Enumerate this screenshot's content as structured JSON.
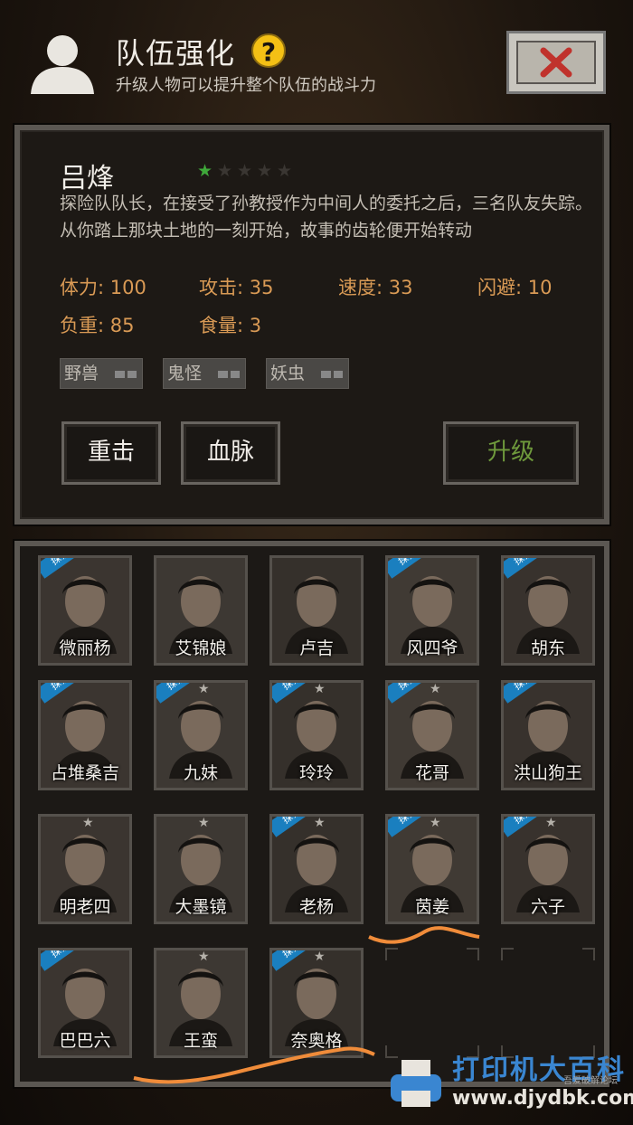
{
  "header": {
    "title": "队伍强化",
    "help_symbol": "?",
    "subtitle": "升级人物可以提升整个队伍的战斗力"
  },
  "character": {
    "name": "吕烽",
    "stars_total": 5,
    "stars_filled": 1,
    "description": "探险队队长，在接受了孙教授作为中间人的委托之后，三名队友失踪。从你踏上那块土地的一刻开始，故事的齿轮便开始转动",
    "stats": {
      "stamina": "体力: 100",
      "attack": "攻击: 35",
      "speed": "速度: 33",
      "dodge": "闪避: 10",
      "load": "负重: 85",
      "food": "食量: 3"
    },
    "tags": [
      "野兽",
      "鬼怪",
      "妖虫"
    ],
    "skills": [
      "重击",
      "血脉"
    ],
    "upgrade_label": "升级"
  },
  "roster": [
    {
      "name": "微丽杨",
      "badge": "探索",
      "star": false
    },
    {
      "name": "艾锦娘",
      "badge": "",
      "star": false
    },
    {
      "name": "卢吉",
      "badge": "",
      "star": false
    },
    {
      "name": "风四爷",
      "badge": "探索",
      "star": false
    },
    {
      "name": "胡东",
      "badge": "探索",
      "star": false
    },
    {
      "name": "占堆桑吉",
      "badge": "探索",
      "star": false
    },
    {
      "name": "九妹",
      "badge": "探索",
      "star": true
    },
    {
      "name": "玲玲",
      "badge": "探索",
      "star": true
    },
    {
      "name": "花哥",
      "badge": "探索",
      "star": true
    },
    {
      "name": "洪山狗王",
      "badge": "探索",
      "star": false
    },
    {
      "name": "明老四",
      "badge": "",
      "star": true
    },
    {
      "name": "大墨镜",
      "badge": "",
      "star": true
    },
    {
      "name": "老杨",
      "badge": "探索",
      "star": true
    },
    {
      "name": "茵姜",
      "badge": "探索",
      "star": true
    },
    {
      "name": "六子",
      "badge": "探索",
      "star": true
    },
    {
      "name": "巴巴六",
      "badge": "探索",
      "star": false
    },
    {
      "name": "王蛮",
      "badge": "",
      "star": true
    },
    {
      "name": "奈奥格",
      "badge": "探索",
      "star": true
    }
  ],
  "watermark": {
    "text": "打印机大百科",
    "url": "www.djydbk.com",
    "small": "吾爱破解论坛"
  },
  "colors": {
    "stat_text": "#d99a55",
    "upgrade_text": "#6f9a3c",
    "star_on": "#3fa83a",
    "badge": "#1a7fbf",
    "help": "#f4c015"
  }
}
